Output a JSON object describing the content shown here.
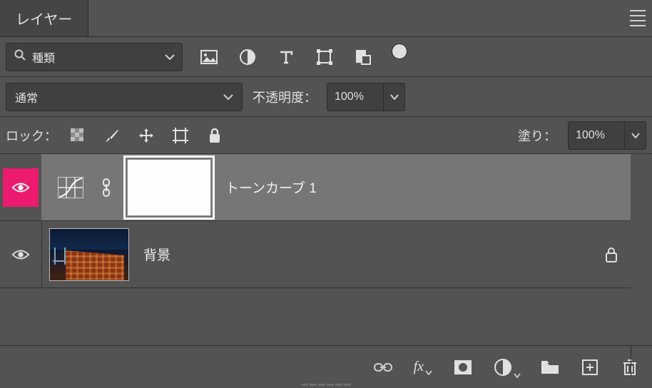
{
  "header": {
    "panel_title": "レイヤー"
  },
  "filter": {
    "search_label": "種類"
  },
  "blend": {
    "mode": "通常",
    "opacity_label": "不透明度：",
    "opacity_value": "100%"
  },
  "lock": {
    "label": "ロック：",
    "fill_label": "塗り：",
    "fill_value": "100%"
  },
  "layers": [
    {
      "name": "トーンカーブ 1",
      "selected": true,
      "type": "adjustment"
    },
    {
      "name": "背景",
      "selected": false,
      "type": "image",
      "locked": true
    }
  ],
  "icons": {
    "menu": "panel-menu",
    "search": "search",
    "image_filter": "image",
    "adjust_filter": "adjust-circle",
    "type_filter": "type",
    "shape_filter": "shape",
    "smart_filter": "smartobject",
    "pixels": "pixels",
    "brush": "brush",
    "move": "move",
    "artboard": "artboard",
    "lock": "lock",
    "eye": "eye",
    "curves": "curves",
    "link_chain": "link",
    "link": "link",
    "fx": "fx",
    "mask": "mask",
    "adjustment": "half-circle",
    "group": "folder",
    "new": "new-layer",
    "trash": "trash"
  }
}
